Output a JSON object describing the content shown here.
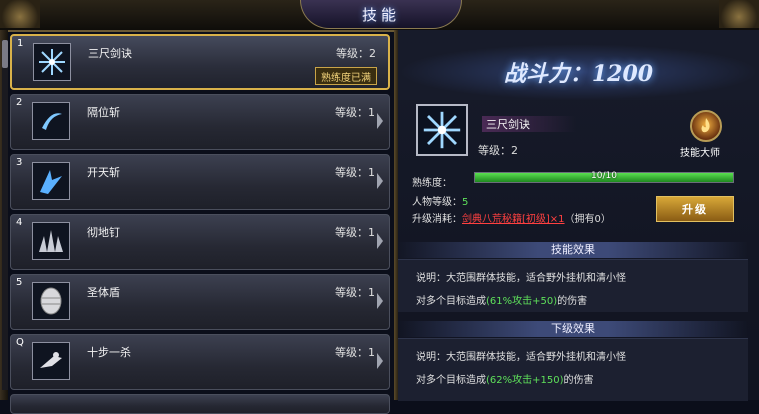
{
  "window": {
    "title": "技能"
  },
  "skills": [
    {
      "num": "1",
      "name": "三尺剑诀",
      "level": "等级：2",
      "badge": "熟练度已满",
      "icon": "snowflake-sword-icon"
    },
    {
      "num": "2",
      "name": "隔位斩",
      "level": "等级：1",
      "icon": "crescent-slash-icon"
    },
    {
      "num": "3",
      "name": "开天斩",
      "level": "等级：1",
      "icon": "sky-cleave-icon"
    },
    {
      "num": "4",
      "name": "彻地钉",
      "level": "等级：1",
      "icon": "ground-spike-icon"
    },
    {
      "num": "5",
      "name": "圣体盾",
      "level": "等级：1",
      "icon": "shield-egg-icon"
    },
    {
      "num": "Q",
      "name": "十步一杀",
      "level": "等级：1",
      "icon": "dash-strike-icon"
    }
  ],
  "detail": {
    "power": "战斗力：1200",
    "skill_name": "三尺剑诀",
    "skill_level": "等级：2",
    "master_label": "技能大师",
    "proficiency_label": "熟练度：",
    "proficiency_value": "10/10",
    "proficiency_fraction": 1.0,
    "char_level_label": "人物等级：",
    "char_level_value": "5",
    "cost_label": "升级消耗：",
    "cost_item": "剑典八荒秘籍[初级]×1",
    "cost_owned": "（拥有0）",
    "upgrade_button": "升级",
    "effect_title": "技能效果",
    "effect_line1": "说明：大范围群体技能，适合野外挂机和清小怪",
    "effect_line2_prefix": "对多个目标造成",
    "effect_line2_value": "(61%攻击+50)",
    "effect_line2_suffix": "的伤害",
    "next_title": "下级效果",
    "next_line1": "说明：大范围群体技能，适合野外挂机和清小怪",
    "next_line2_prefix": "对多个目标造成",
    "next_line2_value": "(62%攻击+150)",
    "next_line2_suffix": "的伤害"
  },
  "colors": {
    "accent_gold": "#d9b24a",
    "green": "#5ee05a",
    "red": "#ff4040"
  }
}
